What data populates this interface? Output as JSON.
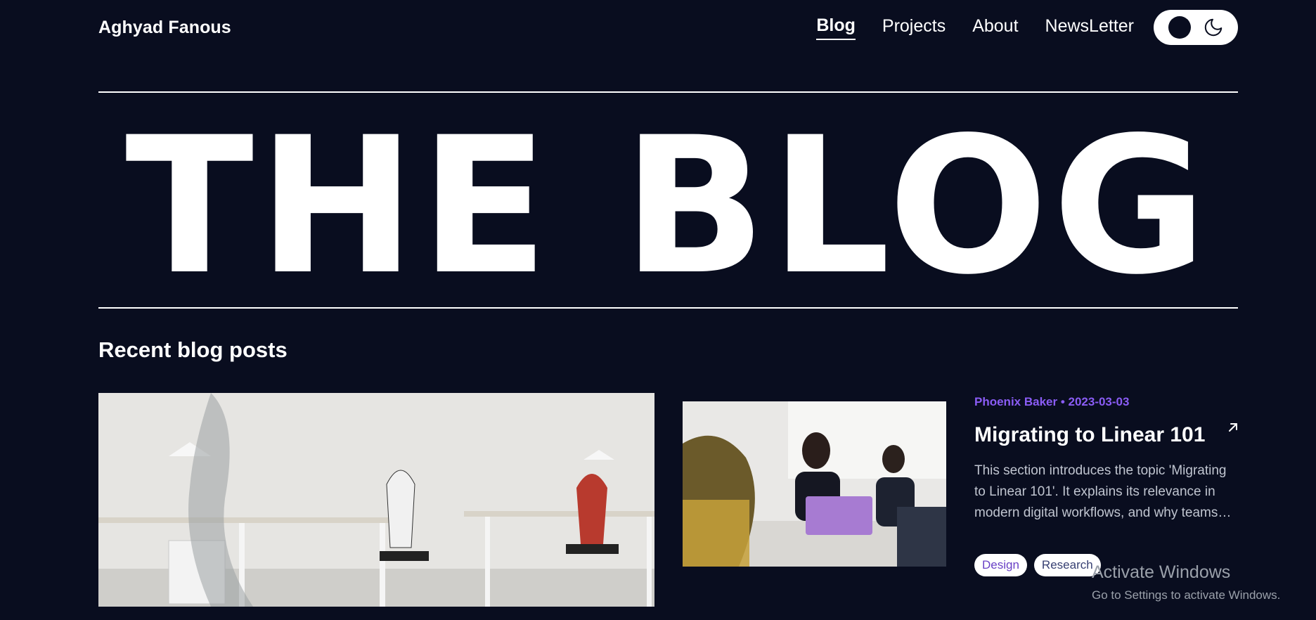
{
  "header": {
    "brand": "Aghyad Fanous",
    "nav": [
      {
        "label": "Blog",
        "active": true
      },
      {
        "label": "Projects",
        "active": false
      },
      {
        "label": "About",
        "active": false
      },
      {
        "label": "NewsLetter",
        "active": false
      }
    ],
    "theme_toggle": {
      "icons": [
        "dark-mode-dot-icon",
        "moon-icon"
      ]
    }
  },
  "hero": {
    "title": "THE BLOG"
  },
  "section": {
    "title": "Recent blog posts"
  },
  "featured": {
    "image": "office-desks-chairs-photo"
  },
  "post": {
    "image": "people-at-laptop-meeting-photo",
    "meta": "Phoenix Baker • 2023-03-03",
    "title": "Migrating to Linear 101",
    "excerpt": "This section introduces the topic 'Migrating to Linear 101'. It explains its relevance in modern digital workflows, and why teams are adopting it today.",
    "tags": [
      "Design",
      "Research"
    ],
    "arrow_icon": "arrow-up-right-icon"
  },
  "colors": {
    "background": "#090d1f",
    "accent": "#6941c6",
    "text": "#ffffff",
    "muted": "#c0c5d0"
  },
  "watermark": {
    "title": "Activate Windows",
    "subtitle": "Go to Settings to activate Windows."
  }
}
